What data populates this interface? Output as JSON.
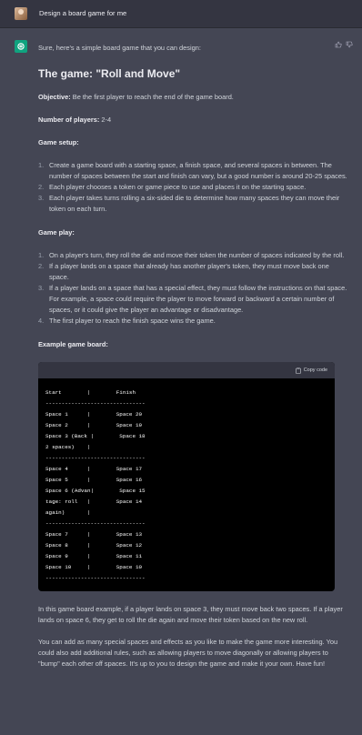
{
  "user": {
    "prompt": "Design a board game for me"
  },
  "response": {
    "intro": "Sure, here's a simple board game that you can design:",
    "title": "The game: \"Roll and Move\"",
    "objective_label": "Objective:",
    "objective_text": " Be the first player to reach the end of the game board.",
    "players_label": "Number of players:",
    "players_text": " 2-4",
    "setup_heading": "Game setup:",
    "setup_items": [
      "Create a game board with a starting space, a finish space, and several spaces in between. The number of spaces between the start and finish can vary, but a good number is around 20-25 spaces.",
      "Each player chooses a token or game piece to use and places it on the starting space.",
      "Each player takes turns rolling a six-sided die to determine how many spaces they can move their token on each turn."
    ],
    "play_heading": "Game play:",
    "play_items": [
      "On a player's turn, they roll the die and move their token the number of spaces indicated by the roll.",
      "If a player lands on a space that already has another player's token, they must move back one space.",
      "If a player lands on a space that has a special effect, they must follow the instructions on that space. For example, a space could require the player to move forward or backward a certain number of spaces, or it could give the player an advantage or disadvantage.",
      "The first player to reach the finish space wins the game."
    ],
    "example_heading": "Example game board:",
    "copy_label": "Copy code",
    "code": "Start        |        Finish\n-------------------------------\nSpace 1      |        Space 20\nSpace 2      |        Space 19\nSpace 3 (Back |        Space 18\n2 spaces)    |\n-------------------------------\nSpace 4      |        Space 17\nSpace 5      |        Space 16\nSpace 6 (Advan|        Space 15\ntage: roll   |        Space 14\nagain)       |\n-------------------------------\nSpace 7      |        Space 13\nSpace 8      |        Space 12\nSpace 9      |        Space 11\nSpace 10     |        Space 10\n-------------------------------",
    "after_code": "In this game board example, if a player lands on space 3, they must move back two spaces. If a player lands on space 6, they get to roll the die again and move their token based on the new roll.",
    "closing": "You can add as many special spaces and effects as you like to make the game more interesting. You could also add additional rules, such as allowing players to move diagonally or allowing players to \"bump\" each other off spaces. It's up to you to design the game and make it your own. Have fun!"
  },
  "colors": {
    "background": "#444654",
    "user_row": "#343541",
    "brand": "#10a37f"
  },
  "icons": [
    "user-avatar",
    "openai-logo-icon",
    "thumbs-up-icon",
    "thumbs-down-icon",
    "clipboard-icon"
  ]
}
